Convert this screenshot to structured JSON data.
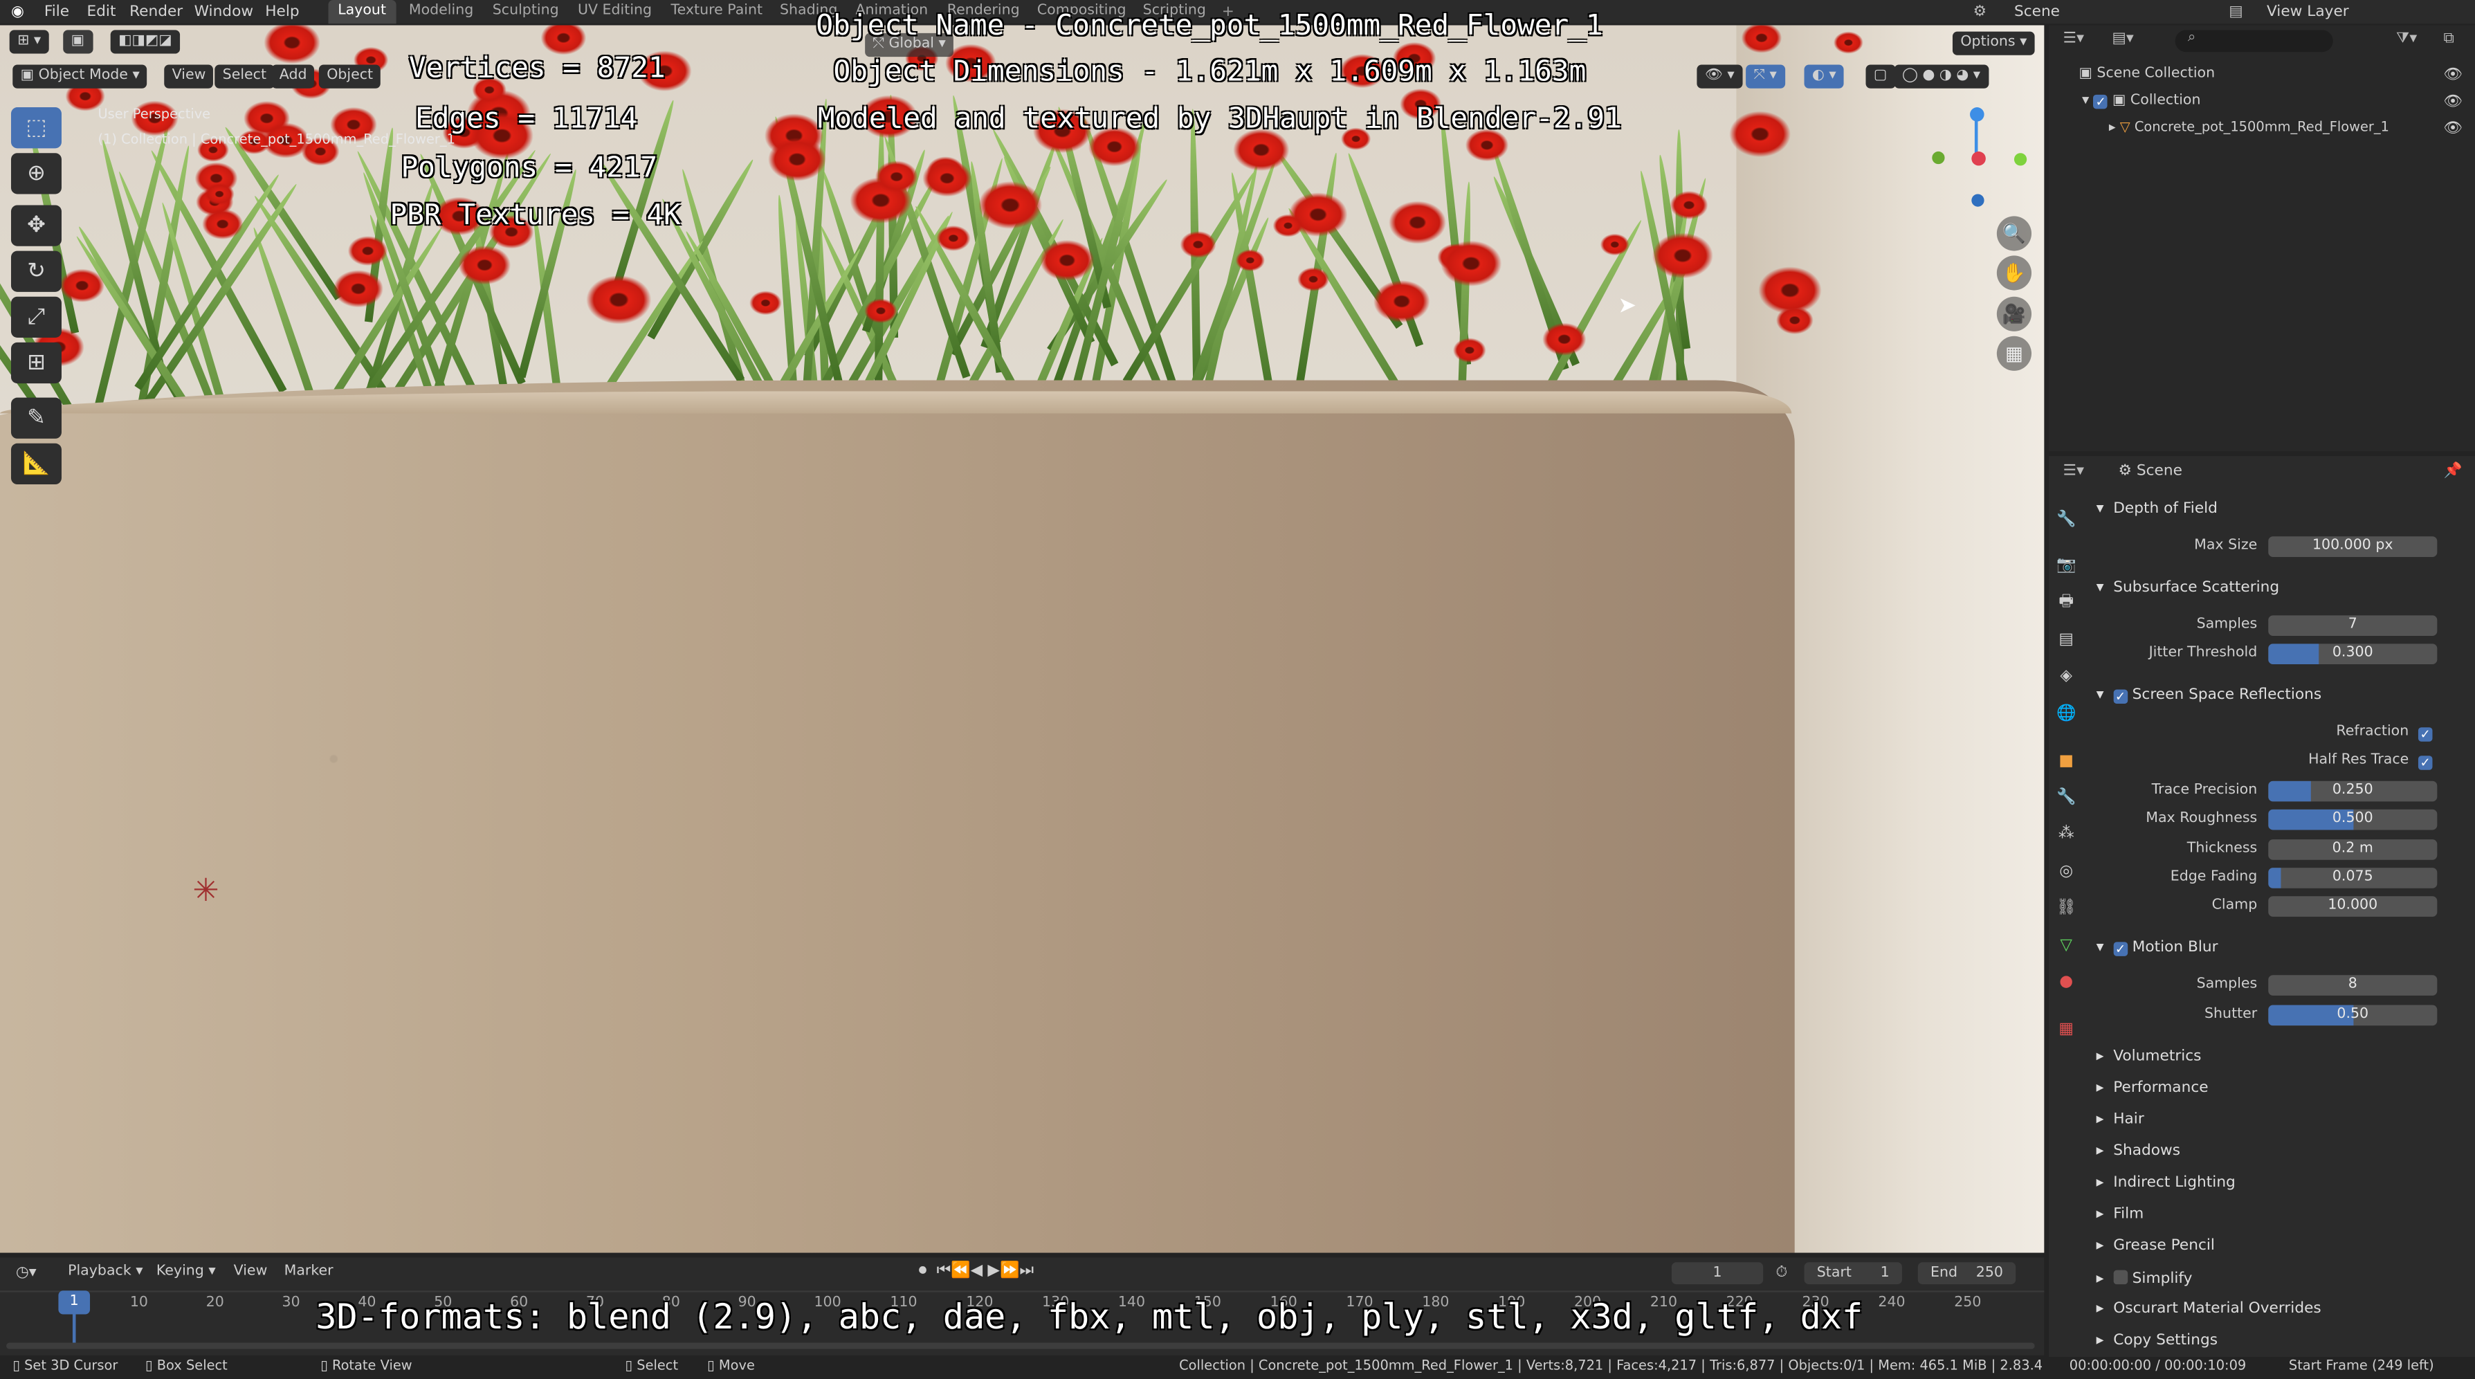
{
  "menu": [
    "File",
    "Edit",
    "Render",
    "Window",
    "Help"
  ],
  "workspaces": [
    {
      "label": "Layout",
      "active": true
    },
    {
      "label": "Modeling",
      "active": false
    },
    {
      "label": "Sculpting",
      "active": false
    },
    {
      "label": "UV Editing",
      "active": false
    },
    {
      "label": "Texture Paint",
      "active": false
    },
    {
      "label": "Shading",
      "active": false
    },
    {
      "label": "Animation",
      "active": false
    },
    {
      "label": "Rendering",
      "active": false
    },
    {
      "label": "Compositing",
      "active": false
    },
    {
      "label": "Scripting",
      "active": false
    }
  ],
  "top_right": {
    "scene": "Scene",
    "view_layer": "View Layer"
  },
  "viewport_header": {
    "mode": "Object Mode",
    "view": "View",
    "select": "Select",
    "add": "Add",
    "object": "Object",
    "transform": "Global",
    "options": "Options"
  },
  "viewport_info": {
    "line1": "User Perspective",
    "line2": "(1) Collection | Concrete_pot_1500mm_Red_Flower_1"
  },
  "overlay": {
    "vertices": "Vertices = 8721",
    "edges": "Edges = 11714",
    "polygons": "Polygons = 4217",
    "pbr": "PBR Textures = 4K",
    "object_name": "Object Name - Concrete_pot_1500mm_Red_Flower_1",
    "object_dimensions": "Object Dimensions - 1.621m x 1.609m x 1.163m",
    "modeled": "Modeled and textured by 3DHaupt in Blender-2.91",
    "formats": "3D-formats: blend (2.9), abc, dae, fbx, mtl, obj, ply, stl, x3d, gltf, dxf"
  },
  "outliner": {
    "scene_collection": "Scene Collection",
    "collection": "Collection",
    "object": "Concrete_pot_1500mm_Red_Flower_1"
  },
  "properties": {
    "title": "Scene",
    "sections": {
      "dof": "Depth of Field",
      "sss": "Subsurface Scattering",
      "ssr": "Screen Space Reflections",
      "motion_blur": "Motion Blur"
    },
    "dof_max_size": {
      "label": "Max Size",
      "value": "100.000 px"
    },
    "sss_samples": {
      "label": "Samples",
      "value": "7"
    },
    "sss_jitter": {
      "label": "Jitter Threshold",
      "value": "0.300",
      "fraction": 0.3
    },
    "ssr_refraction": {
      "label": "Refraction",
      "checked": true
    },
    "ssr_half_res": {
      "label": "Half Res Trace",
      "checked": true
    },
    "ssr_trace_precision": {
      "label": "Trace Precision",
      "value": "0.250",
      "fraction": 0.25
    },
    "ssr_max_roughness": {
      "label": "Max Roughness",
      "value": "0.500",
      "fraction": 0.5
    },
    "ssr_thickness": {
      "label": "Thickness",
      "value": "0.2 m"
    },
    "ssr_edge_fading": {
      "label": "Edge Fading",
      "value": "0.075",
      "fraction": 0.075
    },
    "ssr_clamp": {
      "label": "Clamp",
      "value": "10.000"
    },
    "mb_samples": {
      "label": "Samples",
      "value": "8"
    },
    "mb_shutter": {
      "label": "Shutter",
      "value": "0.50",
      "fraction": 0.5
    },
    "collapsed": [
      "Volumetrics",
      "Performance",
      "Hair",
      "Shadows",
      "Indirect Lighting",
      "Film",
      "Grease Pencil",
      "Simplify",
      "Oscurart Material Overrides",
      "Copy Settings"
    ]
  },
  "timeline": {
    "playback": "Playback",
    "keying": "Keying",
    "view": "View",
    "marker": "Marker",
    "current_frame": "1",
    "start_label": "Start",
    "start": "1",
    "end_label": "End",
    "end": "250",
    "ticks": [
      "1",
      "10",
      "20",
      "30",
      "40",
      "50",
      "60",
      "70",
      "80",
      "90",
      "100",
      "110",
      "120",
      "130",
      "140",
      "150",
      "160",
      "170",
      "180",
      "190",
      "200",
      "210",
      "220",
      "230",
      "240",
      "250"
    ]
  },
  "statusbar": {
    "set_cursor": "Set 3D Cursor",
    "box_select": "Box Select",
    "rotate_view": "Rotate View",
    "select": "Select",
    "move": "Move",
    "stats": "Collection | Concrete_pot_1500mm_Red_Flower_1 | Verts:8,721 | Faces:4,217 | Tris:6,877 | Objects:0/1 | Mem: 465.1 MiB | 2.83.4",
    "time": "00:00:00:00 / 00:00:10:09",
    "start_frame": "Start Frame (249 left)"
  }
}
